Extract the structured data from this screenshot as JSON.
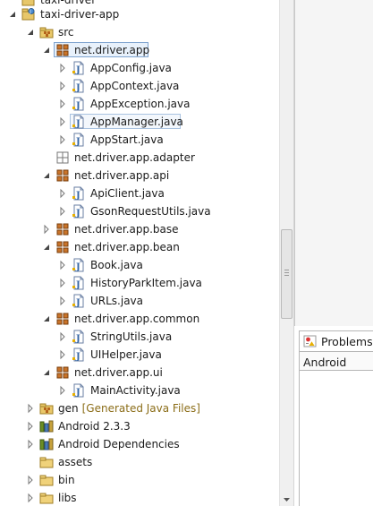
{
  "tree": {
    "items": [
      {
        "label": "taxi-driver",
        "icon": "project-icon"
      },
      {
        "label": "taxi-driver-app",
        "icon": "project-icon",
        "expanded": true
      },
      {
        "label": "src",
        "icon": "source-folder-icon",
        "expanded": true
      },
      {
        "label": "net.driver.app",
        "icon": "package-icon",
        "expanded": true,
        "selected": true
      },
      {
        "label": "AppConfig.java",
        "icon": "java-file-icon"
      },
      {
        "label": "AppContext.java",
        "icon": "java-file-icon"
      },
      {
        "label": "AppException.java",
        "icon": "java-file-icon"
      },
      {
        "label": "AppManager.java",
        "icon": "java-file-icon",
        "focused": true
      },
      {
        "label": "AppStart.java",
        "icon": "java-file-icon"
      },
      {
        "label": "net.driver.app.adapter",
        "icon": "empty-package-icon"
      },
      {
        "label": "net.driver.app.api",
        "icon": "package-icon",
        "expanded": true
      },
      {
        "label": "ApiClient.java",
        "icon": "java-file-icon"
      },
      {
        "label": "GsonRequestUtils.java",
        "icon": "java-file-icon"
      },
      {
        "label": "net.driver.app.base",
        "icon": "package-icon"
      },
      {
        "label": "net.driver.app.bean",
        "icon": "package-icon",
        "expanded": true
      },
      {
        "label": "Book.java",
        "icon": "java-file-icon"
      },
      {
        "label": "HistoryParkItem.java",
        "icon": "java-file-icon"
      },
      {
        "label": "URLs.java",
        "icon": "java-file-icon"
      },
      {
        "label": "net.driver.app.common",
        "icon": "package-icon",
        "expanded": true
      },
      {
        "label": "StringUtils.java",
        "icon": "java-file-icon"
      },
      {
        "label": "UIHelper.java",
        "icon": "java-file-icon"
      },
      {
        "label": "net.driver.app.ui",
        "icon": "package-icon",
        "expanded": true
      },
      {
        "label": "MainActivity.java",
        "icon": "java-file-icon"
      },
      {
        "label": "gen",
        "decoration": "[Generated Java Files]",
        "icon": "source-folder-icon"
      },
      {
        "label": "Android 2.3.3",
        "icon": "library-icon"
      },
      {
        "label": "Android Dependencies",
        "icon": "library-icon"
      },
      {
        "label": "assets",
        "icon": "folder-icon"
      },
      {
        "label": "bin",
        "icon": "folder-icon"
      },
      {
        "label": "libs",
        "icon": "folder-icon"
      }
    ]
  },
  "problems_view": {
    "tab_label": "Problems",
    "tab_icon": "problems-icon",
    "column_header": "Android"
  },
  "colors": {
    "selection_border": "#7da2ce",
    "selection_fill": "#e8f1fb",
    "package_brown": "#b5651d",
    "java_blue": "#3465a4",
    "decoration_text": "#8b6d18"
  }
}
